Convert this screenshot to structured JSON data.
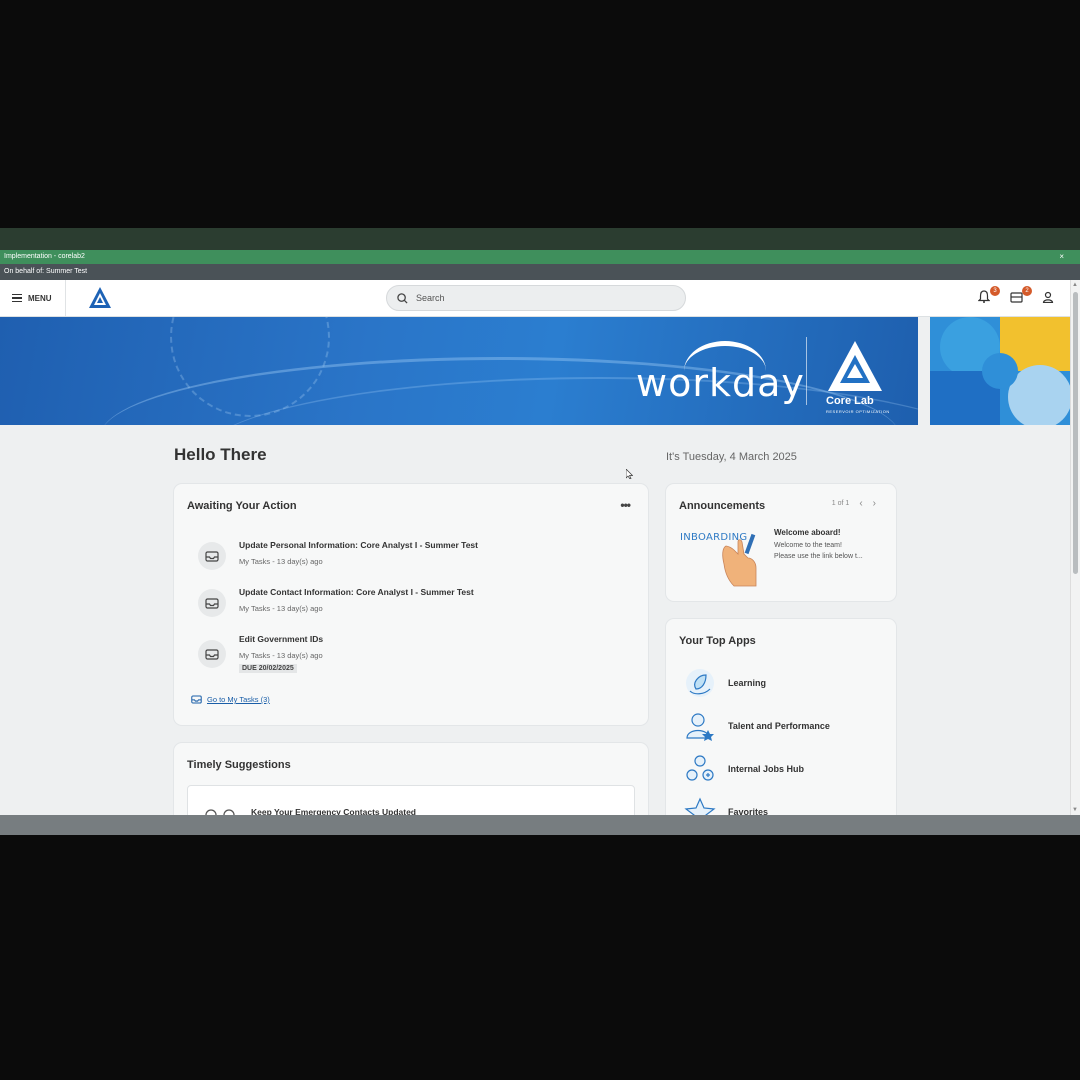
{
  "window": {
    "impl_title": "Implementation - corelab2",
    "close_glyph": "×",
    "on_behalf": "On behalf of: Summer Test"
  },
  "header": {
    "menu_label": "MENU",
    "search_placeholder": "Search",
    "notification_count": "3",
    "inbox_count": "2"
  },
  "banner": {
    "brand": "workday",
    "partner": "Core Lab",
    "partner_tagline": "RESERVOIR OPTIMIZATION"
  },
  "greeting": "Hello There",
  "date_text": "It's Tuesday, 4 March 2025",
  "awaiting": {
    "title": "Awaiting Your Action",
    "more_glyph": "•••",
    "tasks": [
      {
        "title": "Update Personal Information: Core Analyst I - Summer Test",
        "meta": "My Tasks - 13 day(s) ago"
      },
      {
        "title": "Update Contact Information: Core Analyst I - Summer Test",
        "meta": "My Tasks - 13 day(s) ago"
      },
      {
        "title": "Edit Government IDs",
        "meta": "My Tasks - 13 day(s) ago",
        "due": "DUE 20/02/2025"
      }
    ],
    "goto_label": "Go to My Tasks (3)"
  },
  "suggestions": {
    "title": "Timely Suggestions",
    "item": "Keep Your Emergency Contacts Updated"
  },
  "announcements": {
    "title": "Announcements",
    "pager": "1 of 1",
    "prev_glyph": "‹",
    "next_glyph": "›",
    "image_text": "INBOARDING",
    "headline": "Welcome aboard!",
    "body_line1": "Welcome to the team!",
    "body_line2": "Please use the link below t..."
  },
  "top_apps": {
    "title": "Your Top Apps",
    "items": [
      {
        "label": "Learning",
        "icon": "learning-icon"
      },
      {
        "label": "Talent and Performance",
        "icon": "talent-icon"
      },
      {
        "label": "Internal Jobs Hub",
        "icon": "jobs-hub-icon"
      },
      {
        "label": "Favorites",
        "icon": "favorites-icon"
      }
    ]
  },
  "colors": {
    "impl_bar": "#3f8f5c",
    "behalf_bar": "#4a5257",
    "banner_blue": "#2a75c8",
    "link_blue": "#1a5ea8",
    "badge": "#d45a2a"
  }
}
